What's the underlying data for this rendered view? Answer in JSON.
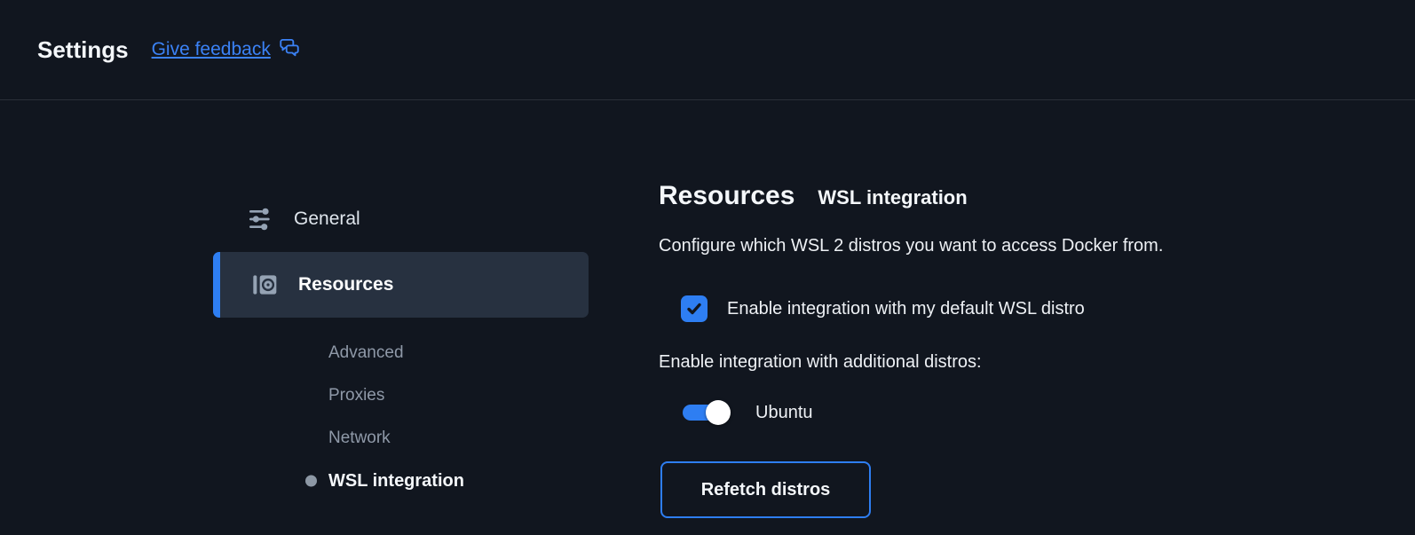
{
  "header": {
    "title": "Settings",
    "feedback_link_label": "Give feedback"
  },
  "sidebar": {
    "items": [
      {
        "label": "General",
        "icon": "tune-icon",
        "selected": false
      },
      {
        "label": "Resources",
        "icon": "storage-icon",
        "selected": true
      }
    ],
    "sub_items": [
      {
        "label": "Advanced",
        "active": false
      },
      {
        "label": "Proxies",
        "active": false
      },
      {
        "label": "Network",
        "active": false
      },
      {
        "label": "WSL integration",
        "active": true
      }
    ]
  },
  "main": {
    "title": "Resources",
    "subtitle": "WSL integration",
    "description": "Configure which WSL 2 distros you want to access Docker from.",
    "default_checkbox": {
      "label": "Enable integration with my default WSL distro",
      "checked": true
    },
    "additional_distros_label": "Enable integration with additional distros:",
    "distros": [
      {
        "name": "Ubuntu",
        "enabled": true
      }
    ],
    "refetch_button_label": "Refetch distros"
  },
  "colors": {
    "background": "#11161f",
    "accent_blue": "#2e7ef2",
    "link_blue": "#3b82f6",
    "selected_item_bg": "#273140",
    "icon_slate": "#95a3b4"
  }
}
